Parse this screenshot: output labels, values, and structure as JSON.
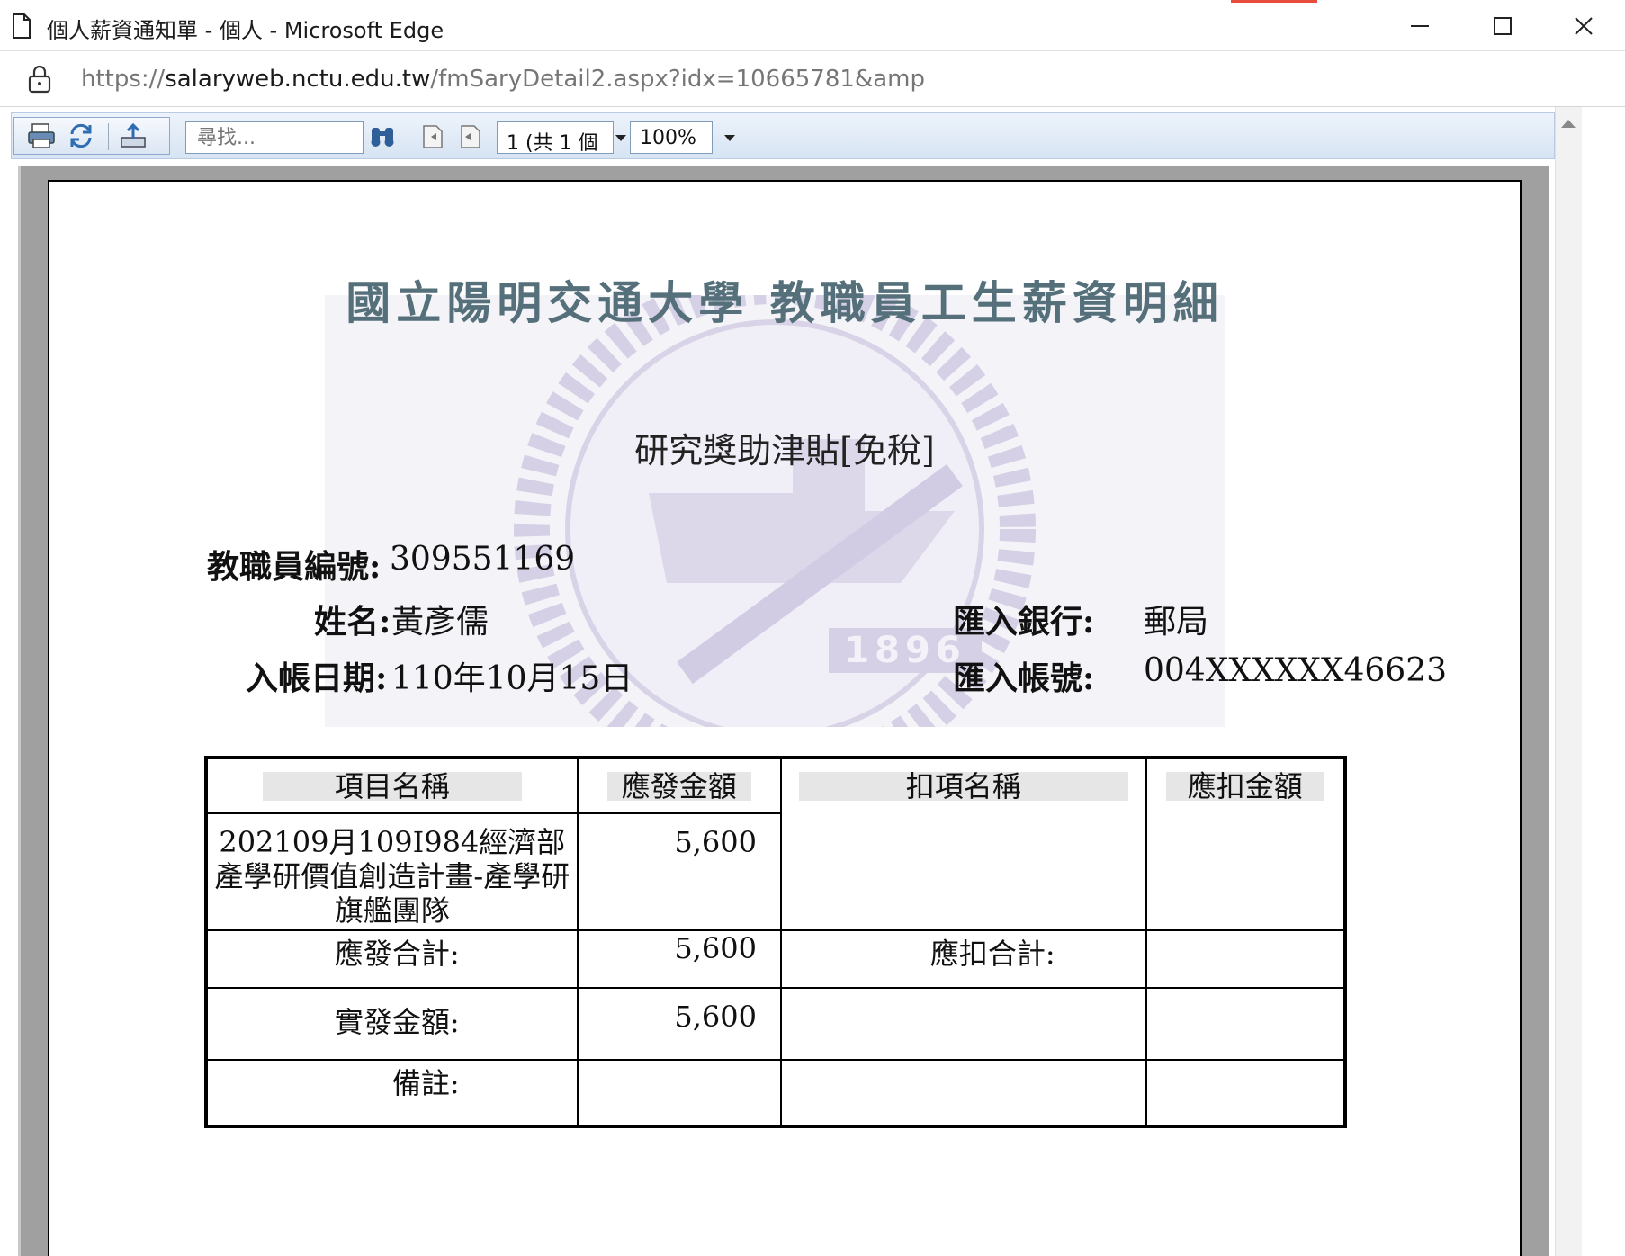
{
  "window": {
    "title": "個人薪資通知單 - 個人 - Microsoft Edge",
    "url_prefix": "https://",
    "url_host": "salaryweb.nctu.edu.tw",
    "url_path": "/fmSaryDetail2.aspx?idx=10665781&amp"
  },
  "toolbar": {
    "find_placeholder": "尋找...",
    "page_value": "1 (共 1 個",
    "zoom_value": "100%"
  },
  "report": {
    "title": "國立陽明交通大學  教職員工生薪資明細",
    "watermark_year": "1896",
    "subtitle": "研究獎助津貼[免稅]",
    "employee_id_label": "教職員編號:",
    "employee_id": "309551169",
    "name_label": "姓名:",
    "name": "黃彥儒",
    "date_label": "入帳日期:",
    "date": "110年10月15日",
    "bank_label": "匯入銀行:",
    "bank": "郵局",
    "account_label": "匯入帳號:",
    "account": "004XXXXXX46623"
  },
  "table": {
    "headers": {
      "item_name": "項目名稱",
      "pay_amount": "應發金額",
      "deduction_name": "扣項名稱",
      "deduction_amount": "應扣金額"
    },
    "rows": [
      {
        "item_name": "202109月109I984經濟部產學研價值創造計畫-產學研旗艦團隊",
        "pay_amount": "5,600"
      }
    ],
    "total_pay_label": "應發合計:",
    "total_pay": "5,600",
    "total_deduction_label": "應扣合計:",
    "net_pay_label": "實發金額:",
    "net_pay": "5,600",
    "remarks_label": "備註:"
  }
}
